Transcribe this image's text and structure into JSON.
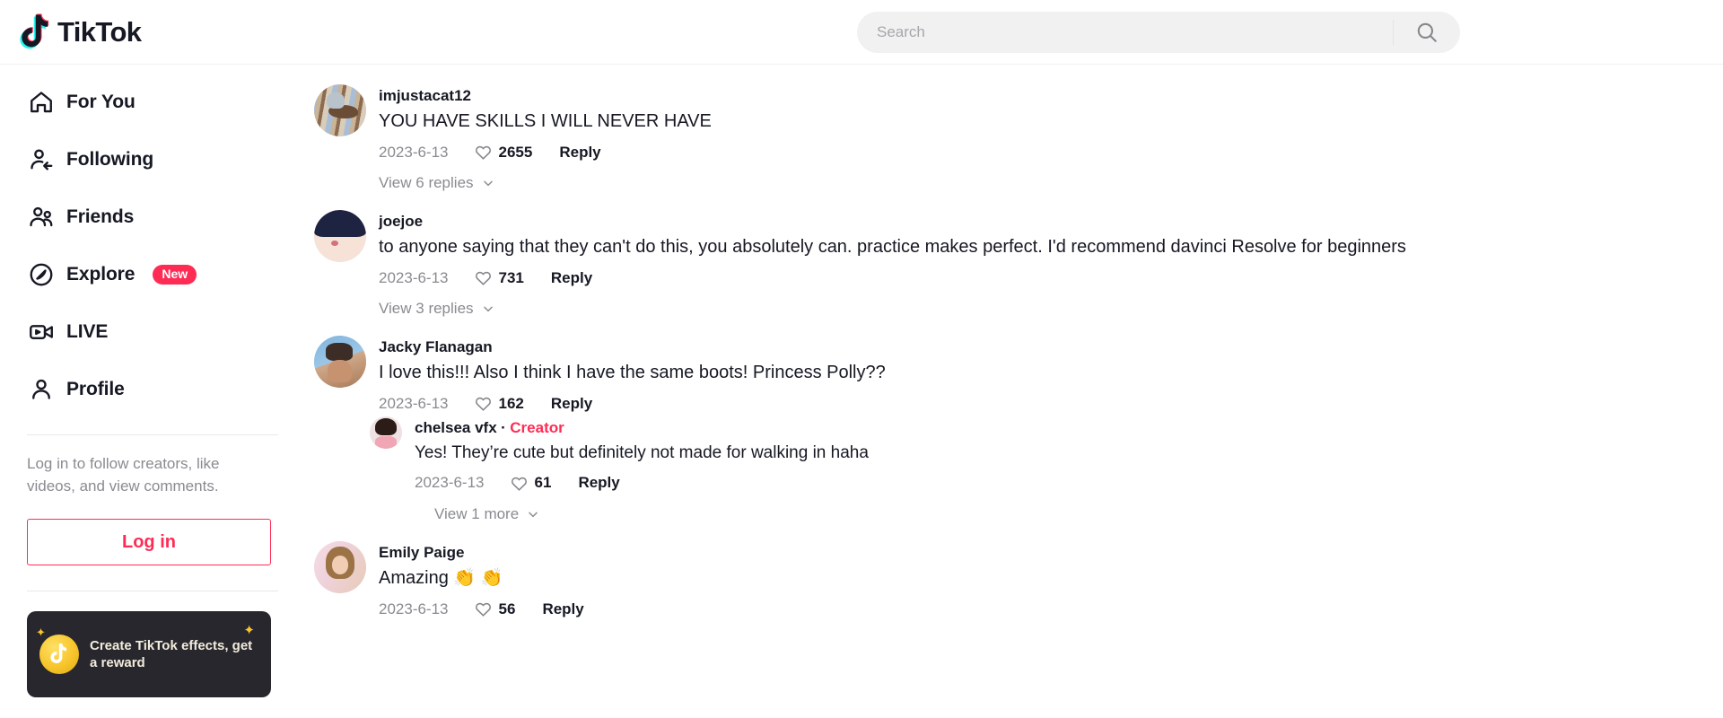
{
  "header": {
    "brand": "TikTok",
    "logo_icon": "tiktok-note-icon",
    "search": {
      "placeholder": "Search",
      "value": "",
      "icon": "search-icon"
    }
  },
  "sidebar": {
    "items": [
      {
        "label": "For You",
        "icon": "home-icon"
      },
      {
        "label": "Following",
        "icon": "user-follow-icon"
      },
      {
        "label": "Friends",
        "icon": "users-icon"
      },
      {
        "label": "Explore",
        "icon": "compass-icon",
        "badge": "New"
      },
      {
        "label": "LIVE",
        "icon": "live-video-icon"
      },
      {
        "label": "Profile",
        "icon": "user-icon"
      }
    ],
    "login_prompt": "Log in to follow creators, like videos, and view comments.",
    "login_button": "Log in",
    "promo": {
      "text": "Create TikTok effects, get a reward",
      "icon": "coin-tiktok-icon"
    }
  },
  "comments": [
    {
      "username": "imjustacat12",
      "avatar": "cat-avatar",
      "text": "YOU HAVE SKILLS I WILL NEVER HAVE",
      "date": "2023-6-13",
      "likes": "2655",
      "reply_label": "Reply",
      "view_replies": "View 6 replies"
    },
    {
      "username": "joejoe",
      "avatar": "anime-avatar",
      "text": "to anyone saying that they can't do this, you absolutely can. practice makes perfect. I'd recommend davinci Resolve for beginners",
      "date": "2023-6-13",
      "likes": "731",
      "reply_label": "Reply",
      "view_replies": "View 3 replies"
    },
    {
      "username": "Jacky Flanagan",
      "avatar": "sunglasses-avatar",
      "text": "I love this!!! Also I think I have the same boots! Princess Polly??",
      "date": "2023-6-13",
      "likes": "162",
      "reply_label": "Reply",
      "reply": {
        "username": "chelsea vfx",
        "separator": "·",
        "creator_badge": "Creator",
        "avatar": "chelsea-avatar",
        "text": "Yes! They’re cute but definitely not made for walking in haha",
        "date": "2023-6-13",
        "likes": "61",
        "reply_label": "Reply"
      },
      "view_more": "View 1 more"
    },
    {
      "username": "Emily Paige",
      "avatar": "emily-avatar",
      "text": "Amazing 👏 👏",
      "date": "2023-6-13",
      "likes": "56",
      "reply_label": "Reply"
    }
  ],
  "colors": {
    "brand_red": "#fe2c55",
    "brand_cyan": "#25f4ee",
    "text_primary": "#161823",
    "text_secondary": "#8a8b91",
    "search_bg": "#f1f1f2"
  }
}
